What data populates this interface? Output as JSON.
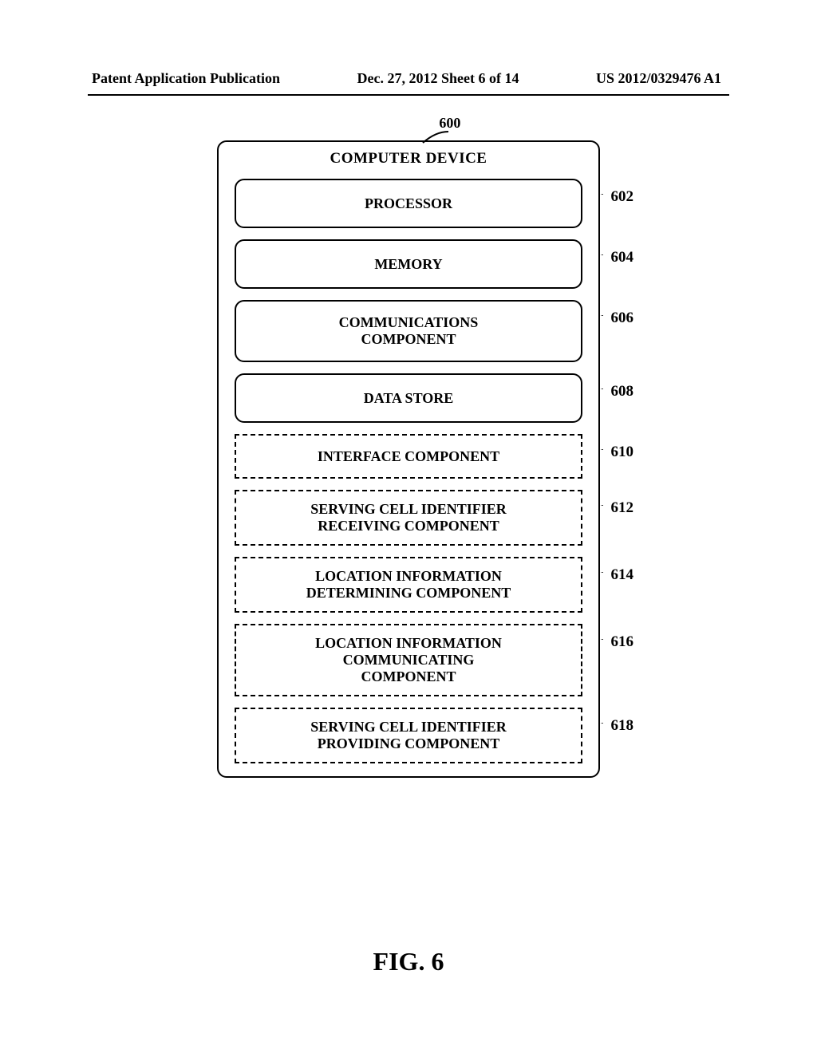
{
  "header": {
    "left": "Patent Application Publication",
    "middle": "Dec. 27, 2012  Sheet 6 of 14",
    "right": "US 2012/0329476 A1"
  },
  "diagram": {
    "ref600": "600",
    "outerTitle": "COMPUTER DEVICE",
    "blocks": [
      {
        "ref": "602",
        "label1": "PROCESSOR",
        "label2": "",
        "dashed": false
      },
      {
        "ref": "604",
        "label1": "MEMORY",
        "label2": "",
        "dashed": false
      },
      {
        "ref": "606",
        "label1": "COMMUNICATIONS",
        "label2": "COMPONENT",
        "dashed": false
      },
      {
        "ref": "608",
        "label1": "DATA STORE",
        "label2": "",
        "dashed": false
      },
      {
        "ref": "610",
        "label1": "INTERFACE COMPONENT",
        "label2": "",
        "dashed": true
      },
      {
        "ref": "612",
        "label1": "SERVING CELL IDENTIFIER",
        "label2": "RECEIVING COMPONENT",
        "dashed": true
      },
      {
        "ref": "614",
        "label1": "LOCATION INFORMATION",
        "label2": "DETERMINING COMPONENT",
        "dashed": true
      },
      {
        "ref": "616",
        "label1": "LOCATION INFORMATION",
        "label2": "COMMUNICATING",
        "label3": "COMPONENT",
        "dashed": true
      },
      {
        "ref": "618",
        "label1": "SERVING CELL IDENTIFIER",
        "label2": "PROVIDING COMPONENT",
        "dashed": true
      }
    ]
  },
  "figLabel": "FIG. 6"
}
